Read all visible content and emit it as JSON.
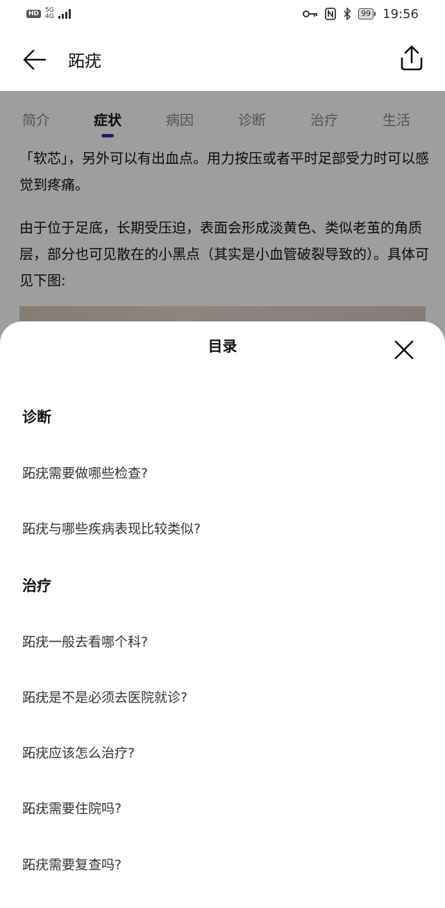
{
  "status_bar": {
    "hd": "HD",
    "net_top": "5G",
    "net_bottom": "4G",
    "battery": "99",
    "time": "19:56",
    "icons": [
      "key-icon",
      "nfc-icon",
      "bluetooth-icon"
    ]
  },
  "header": {
    "title": "跖疣",
    "back_icon": "arrow-left-icon",
    "share_icon": "share-icon"
  },
  "tabs": [
    {
      "label": "简介",
      "active": false
    },
    {
      "label": "症状",
      "active": true
    },
    {
      "label": "病因",
      "active": false
    },
    {
      "label": "诊断",
      "active": false
    },
    {
      "label": "治疗",
      "active": false
    },
    {
      "label": "生活",
      "active": false
    }
  ],
  "article": {
    "paragraphs": [
      "「软芯」，另外可以有出血点。用力按压或者平时足部受力时可以感觉到疼痛。",
      "由于位于足底，长期受压迫，表面会形成淡黄色、类似老茧的角质层，部分也可见散在的小黑点（其实是小血管破裂导致的）。具体可见下图:"
    ]
  },
  "sheet": {
    "title": "目录",
    "close_icon": "close-icon",
    "sections": [
      {
        "title": "诊断",
        "items": [
          "跖疣需要做哪些检查?",
          "跖疣与哪些疾病表现比较类似?"
        ]
      },
      {
        "title": "治疗",
        "items": [
          "跖疣一般去看哪个科?",
          "跖疣是不是必须去医院就诊?",
          "跖疣应该怎么治疗?",
          "跖疣需要住院吗?",
          "跖疣需要复查吗?"
        ]
      }
    ]
  },
  "colors": {
    "accent": "#3b2ea0",
    "overlay": "rgba(0,0,0,0.38)"
  }
}
